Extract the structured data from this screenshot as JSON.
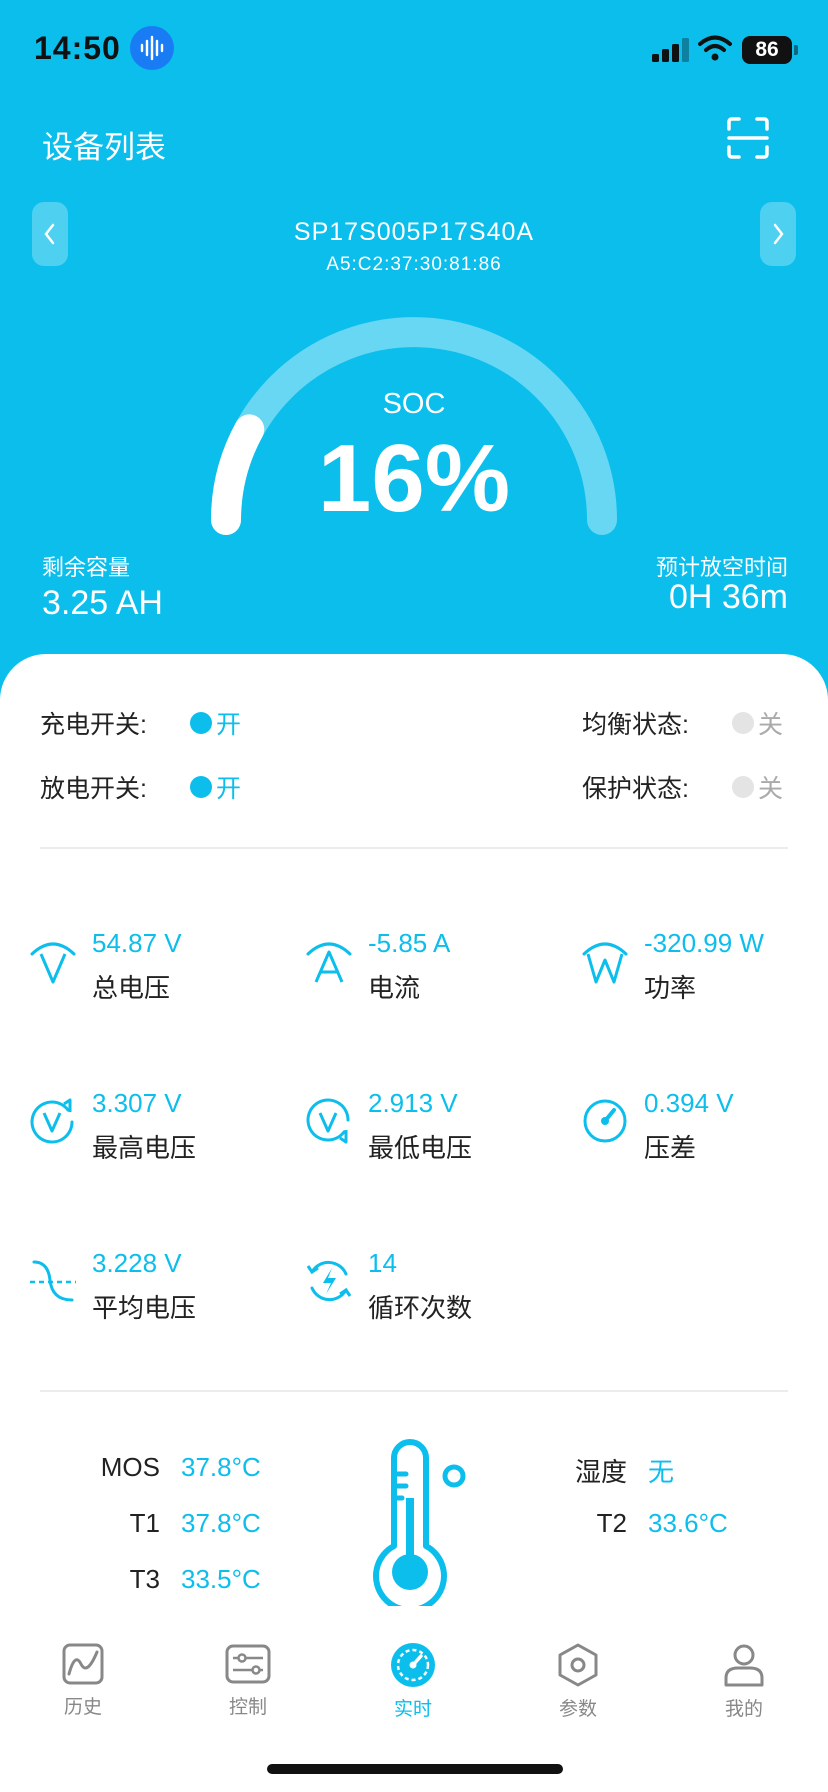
{
  "status_bar": {
    "time": "14:50",
    "battery": "86"
  },
  "header": {
    "title": "设备列表"
  },
  "device": {
    "name": "SP17S005P17S40A",
    "mac": "A5:C2:37:30:81:86"
  },
  "soc": {
    "label": "SOC",
    "value": "16%",
    "level": 0.16
  },
  "remaining": {
    "label": "剩余容量",
    "value": "3.25 AH"
  },
  "discharge_time": {
    "label": "预计放空时间",
    "value": "0H 36m"
  },
  "switches": {
    "charge": {
      "label": "充电开关:",
      "state": "开"
    },
    "discharge": {
      "label": "放电开关:",
      "state": "开"
    },
    "balance": {
      "label": "均衡状态:",
      "state": "关"
    },
    "protect": {
      "label": "保护状态:",
      "state": "关"
    }
  },
  "metrics": {
    "total_voltage": {
      "value": "54.87 V",
      "name": "总电压"
    },
    "current": {
      "value": "-5.85 A",
      "name": "电流"
    },
    "power": {
      "value": "-320.99 W",
      "name": "功率"
    },
    "max_voltage": {
      "value": "3.307 V",
      "name": "最高电压"
    },
    "min_voltage": {
      "value": "2.913 V",
      "name": "最低电压"
    },
    "diff": {
      "value": "0.394 V",
      "name": "压差"
    },
    "avg_voltage": {
      "value": "3.228 V",
      "name": "平均电压"
    },
    "cycles": {
      "value": "14",
      "name": "循环次数"
    }
  },
  "temperatures": {
    "mos": {
      "label": "MOS",
      "value": "37.8°C"
    },
    "t1": {
      "label": "T1",
      "value": "37.8°C"
    },
    "t3": {
      "label": "T3",
      "value": "33.5°C"
    },
    "humidity": {
      "label": "湿度",
      "value": "无"
    },
    "t2": {
      "label": "T2",
      "value": "33.6°C"
    }
  },
  "tabs": [
    {
      "label": "历史",
      "icon": "history-chart-icon"
    },
    {
      "label": "控制",
      "icon": "control-sliders-icon"
    },
    {
      "label": "实时",
      "icon": "realtime-gauge-icon"
    },
    {
      "label": "参数",
      "icon": "params-hexagon-icon"
    },
    {
      "label": "我的",
      "icon": "user-icon"
    }
  ],
  "colors": {
    "accent": "#0BBEEC",
    "text": "#222222",
    "muted": "#888888"
  }
}
